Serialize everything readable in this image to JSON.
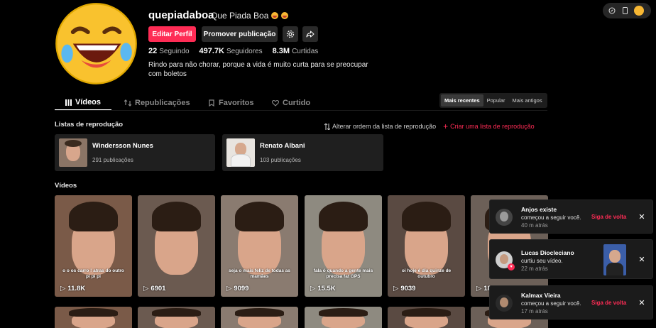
{
  "profile": {
    "username": "quepiadaboa",
    "nickname": "Que Piada Boa",
    "buttons": {
      "edit": "Editar Perfil",
      "promote": "Promover publicação"
    },
    "stats": [
      {
        "value": "22",
        "label": "Seguindo"
      },
      {
        "value": "497.7K",
        "label": "Seguidores"
      },
      {
        "value": "8.3M",
        "label": "Curtidas"
      }
    ],
    "bio": "Rindo para não chorar, porque a vida é muito curta para se preocupar com boletos"
  },
  "tabs": [
    {
      "label": "Vídeos",
      "icon": "grid-icon",
      "active": true
    },
    {
      "label": "Republicações",
      "icon": "repost-icon"
    },
    {
      "label": "Favoritos",
      "icon": "bookmark-icon"
    },
    {
      "label": "Curtido",
      "icon": "heart-icon"
    }
  ],
  "sort": [
    "Mais recentes",
    "Popular",
    "Mais antigos"
  ],
  "playlists": {
    "title": "Listas de reprodução",
    "reorder": "Alterar ordem da lista de reprodução",
    "create": "Criar uma lista de reprodução",
    "items": [
      {
        "name": "Windersson Nunes",
        "count": "291 publicações"
      },
      {
        "name": "Renato Albani",
        "count": "103 publicações"
      }
    ]
  },
  "videos": {
    "title": "Vídeos",
    "items": [
      {
        "views": "11.8K",
        "caption": "o o os carro ! atras do outro pi pi pi",
        "bg": "#7a5a48"
      },
      {
        "views": "6901",
        "caption": "",
        "bg": "#6b5a50"
      },
      {
        "views": "9099",
        "caption": "seja o mais feliz de todas as mamães",
        "bg": "#8a7b70"
      },
      {
        "views": "15.5K",
        "caption": "fala ó quando a gente mais precisa fat GPS",
        "bg": "#8e8a80"
      },
      {
        "views": "9039",
        "caption": "oi hoje é dia quinze de outubro",
        "bg": "#5a4a42"
      },
      {
        "views": "18",
        "caption": "",
        "bg": "#6c6058"
      }
    ]
  },
  "notifications": [
    {
      "name": "Anjos existe",
      "action": "começou a seguir você.",
      "time": "40 m atrás",
      "follow": "Siga de volta"
    },
    {
      "name": "Lucas Diocleciano",
      "action": "curtiu seu vídeo.",
      "time": "22 m atrás"
    },
    {
      "name": "Kalmax Vieira",
      "action": "começou a seguir você.",
      "time": "17 m atrás",
      "follow": "Siga de volta"
    }
  ],
  "colors": {
    "accent": "#fe2c55",
    "background": "#000000"
  }
}
